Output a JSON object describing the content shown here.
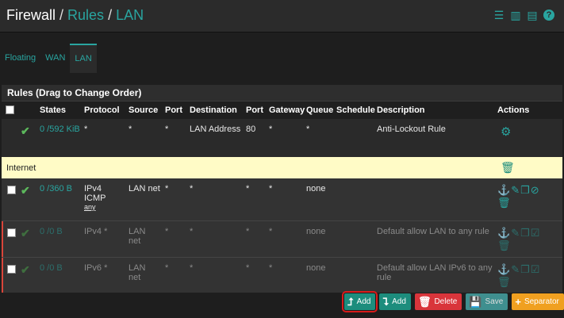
{
  "breadcrumb": {
    "c0": "Firewall",
    "c1": "Rules",
    "c2": "LAN",
    "sep": "/"
  },
  "header_icons": [
    "sliders-icon",
    "bar-chart-icon",
    "list-icon",
    "help-icon"
  ],
  "tabs": [
    {
      "label": "Floating"
    },
    {
      "label": "WAN"
    },
    {
      "label": "LAN",
      "active": true
    }
  ],
  "panel": {
    "title": "Rules (Drag to Change Order)"
  },
  "columns": {
    "states": "States",
    "protocol": "Protocol",
    "source": "Source",
    "port": "Port",
    "destination": "Destination",
    "port2": "Port",
    "gateway": "Gateway",
    "queue": "Queue",
    "schedule": "Schedule",
    "description": "Description",
    "actions": "Actions"
  },
  "rows": {
    "anti": {
      "states": "0 /592 KiB",
      "protocol": "*",
      "source": "*",
      "port": "*",
      "destination": "LAN Address",
      "port2": "80",
      "gateway": "*",
      "queue": "*",
      "description": "Anti-Lockout Rule"
    },
    "separator": {
      "label": "Internet"
    },
    "r1": {
      "states": "0 /360 B",
      "protocol": "IPv4 ICMP",
      "protocol_sub": "any",
      "source": "LAN net",
      "port": "*",
      "destination": "*",
      "port2": "*",
      "gateway": "*",
      "queue": "none",
      "description": ""
    },
    "r2": {
      "states": "0 /0 B",
      "protocol": "IPv4 *",
      "source": "LAN net",
      "port": "*",
      "destination": "*",
      "port2": "*",
      "gateway": "*",
      "queue": "none",
      "description": "Default allow LAN to any rule"
    },
    "r3": {
      "states": "0 /0 B",
      "protocol": "IPv6 *",
      "source": "LAN net",
      "port": "*",
      "destination": "*",
      "port2": "*",
      "gateway": "*",
      "queue": "none",
      "description": "Default allow LAN IPv6 to any rule"
    }
  },
  "buttons": {
    "add_top": "Add",
    "add_bottom": "Add",
    "delete": "Delete",
    "save": "Save",
    "separator": "Separator"
  },
  "colors": {
    "accent": "#29a5a0",
    "separator_row": "#fffbc6",
    "delete": "#d9353b",
    "separator_btn": "#f0a020"
  }
}
